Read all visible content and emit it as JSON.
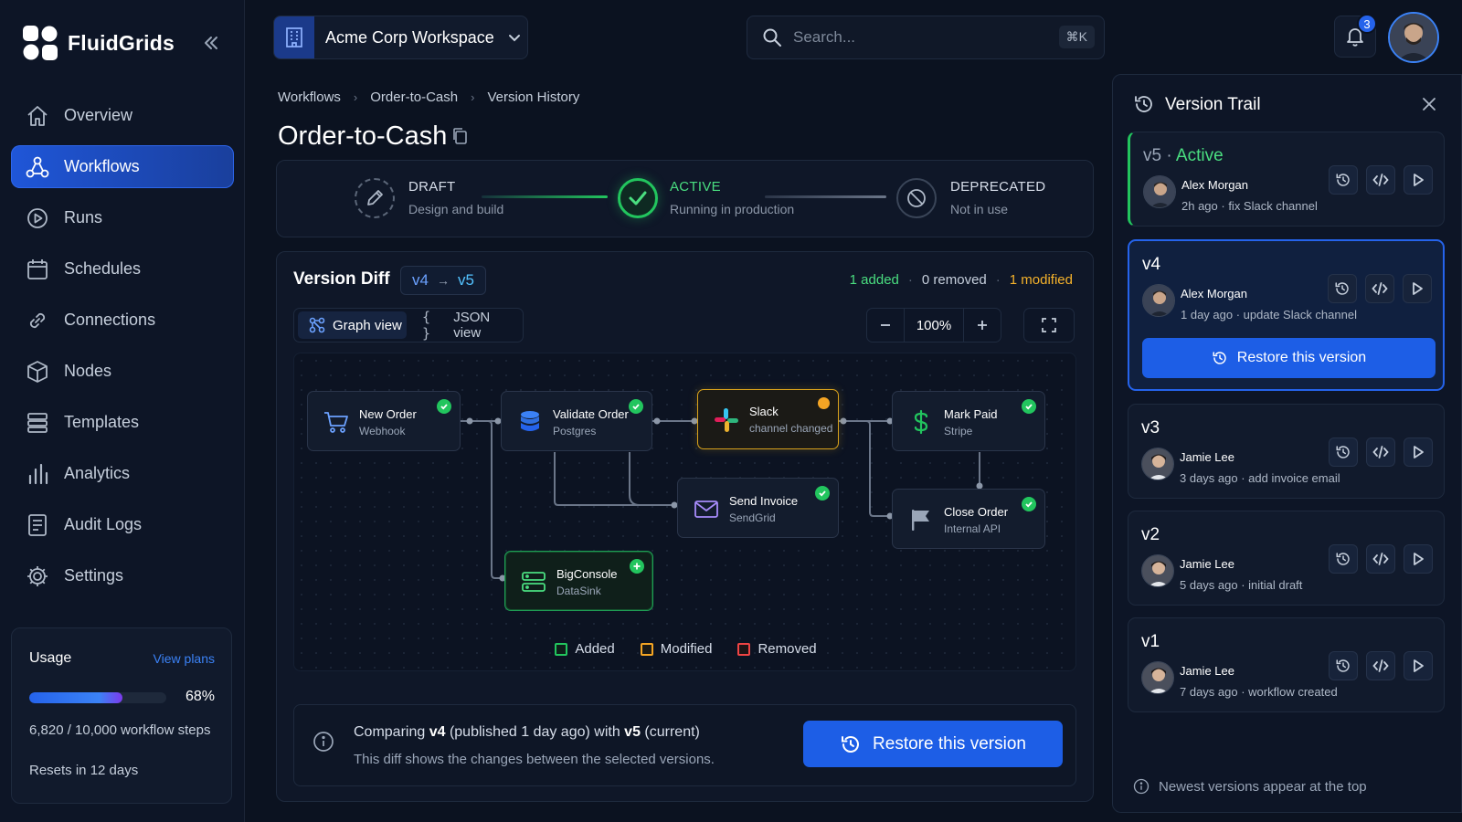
{
  "brand": {
    "name": "FluidGrids"
  },
  "sidebar": {
    "items": [
      {
        "label": "Overview",
        "icon": "home-icon"
      },
      {
        "label": "Workflows",
        "icon": "workflow-icon",
        "active": true
      },
      {
        "label": "Runs",
        "icon": "play-circle-icon"
      },
      {
        "label": "Schedules",
        "icon": "calendar-icon"
      },
      {
        "label": "Connections",
        "icon": "link-icon"
      },
      {
        "label": "Nodes",
        "icon": "cube-icon"
      },
      {
        "label": "Templates",
        "icon": "templates-icon"
      },
      {
        "label": "Analytics",
        "icon": "bar-chart-icon"
      },
      {
        "label": "Audit Logs",
        "icon": "document-icon"
      },
      {
        "label": "Settings",
        "icon": "gear-icon"
      }
    ],
    "usage": {
      "title": "Usage",
      "link": "View plans",
      "percent_label": "68%",
      "fraction": 0.68,
      "steps": "6,820 / 10,000 workflow steps",
      "reset": "Resets in 12 days"
    }
  },
  "topbar": {
    "workspace": "Acme Corp Workspace",
    "search_placeholder": "Search...",
    "search_shortcut": "⌘K",
    "notifications_count": "3"
  },
  "breadcrumb": [
    "Workflows",
    "Order-to-Cash",
    "Version History"
  ],
  "page_title": "Order-to-Cash",
  "lifecycle": {
    "stages": [
      {
        "label": "DRAFT",
        "sub": "Design and build"
      },
      {
        "label": "ACTIVE",
        "sub": "Running in production"
      },
      {
        "label": "DEPRECATED",
        "sub": "Not in use"
      }
    ]
  },
  "diff": {
    "title": "Version Diff",
    "from": "v4",
    "to": "v5",
    "stats": {
      "added": "1 added",
      "removed": "0 removed",
      "modified": "1 modified"
    },
    "views": {
      "graph": "Graph view",
      "json": "JSON view"
    },
    "zoom": "100%",
    "nodes": {
      "new_order": {
        "title": "New Order",
        "sub": "Webhook"
      },
      "validate": {
        "title": "Validate Order",
        "sub": "Postgres"
      },
      "slack": {
        "title": "Slack",
        "sub": "channel changed"
      },
      "mark_paid": {
        "title": "Mark Paid",
        "sub": "Stripe"
      },
      "send_invoice": {
        "title": "Send Invoice",
        "sub": "SendGrid"
      },
      "close_order": {
        "title": "Close Order",
        "sub": "Internal API"
      },
      "bigconsole": {
        "title": "BigConsole",
        "sub": "DataSink"
      }
    },
    "legend": {
      "added": "Added",
      "modified": "Modified",
      "removed": "Removed"
    },
    "compare": {
      "prefix": "Comparing ",
      "from": "v4",
      "mid": " (published 1 day ago) with ",
      "to": "v5",
      "suffix": " (current)",
      "line2": "This diff shows the changes between the selected versions.",
      "button": "Restore this version"
    }
  },
  "version_trail": {
    "title": "Version Trail",
    "versions": [
      {
        "ver": "v5",
        "sep": " · ",
        "status": "Active",
        "author": "Alex Morgan",
        "meta": "2h ago · fix Slack channel"
      },
      {
        "ver": "v4",
        "author": "Alex Morgan",
        "meta": "1 day ago · update Slack channel",
        "button": "Restore this version"
      },
      {
        "ver": "v3",
        "author": "Jamie Lee",
        "meta": "3 days ago · add invoice email"
      },
      {
        "ver": "v2",
        "author": "Jamie Lee",
        "meta": "5 days ago · initial draft"
      },
      {
        "ver": "v1",
        "author": "Jamie Lee",
        "meta": "7 days ago · workflow created"
      }
    ],
    "footer": "Newest versions appear at the top"
  }
}
